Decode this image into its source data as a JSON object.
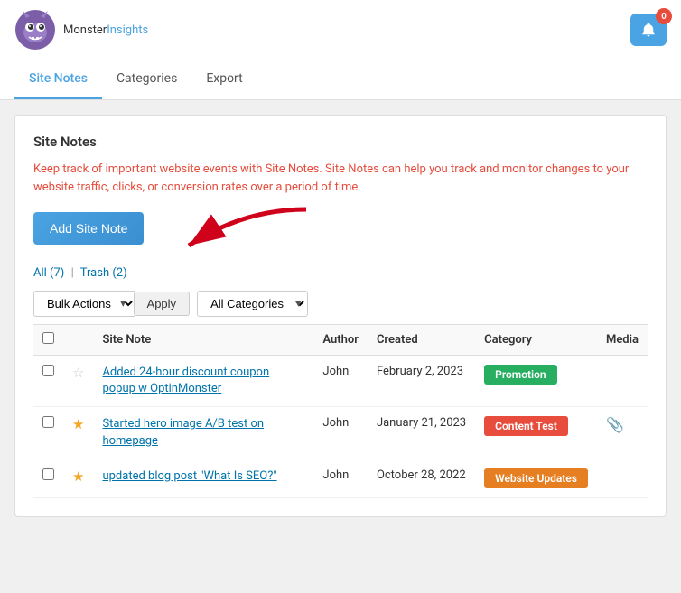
{
  "header": {
    "logo_monster": "Monster",
    "logo_insights": "Insights",
    "notification_count": "0"
  },
  "nav": {
    "tabs": [
      {
        "id": "site-notes",
        "label": "Site Notes",
        "active": true
      },
      {
        "id": "categories",
        "label": "Categories",
        "active": false
      },
      {
        "id": "export",
        "label": "Export",
        "active": false
      }
    ]
  },
  "main": {
    "section_title": "Site Notes",
    "description": "Keep track of important website events with Site Notes. Site Notes can help you track and monitor changes to your website traffic, clicks, or conversion rates over a period of time.",
    "add_button_label": "Add Site Note",
    "filter": {
      "all_label": "All",
      "all_count": "(7)",
      "trash_label": "Trash",
      "trash_count": "(2)",
      "bulk_actions_label": "Bulk Actions",
      "apply_label": "Apply",
      "categories_label": "All Categories"
    },
    "table": {
      "headers": [
        "",
        "",
        "Site Note",
        "Author",
        "Created",
        "Category",
        "Media"
      ],
      "rows": [
        {
          "starred": false,
          "note": "Added 24-hour discount coupon popup w OptinMonster",
          "author": "John",
          "created": "February 2, 2023",
          "category": "Promotion",
          "category_class": "badge-promotion",
          "media": ""
        },
        {
          "starred": true,
          "note": "Started hero image A/B test on homepage",
          "author": "John",
          "created": "January 21, 2023",
          "category": "Content Test",
          "category_class": "badge-content-test",
          "media": "📎"
        },
        {
          "starred": true,
          "note": "updated blog post \"What Is SEO?\"",
          "author": "John",
          "created": "October 28, 2022",
          "category": "Website Updates",
          "category_class": "badge-website-updates",
          "media": ""
        }
      ]
    }
  }
}
